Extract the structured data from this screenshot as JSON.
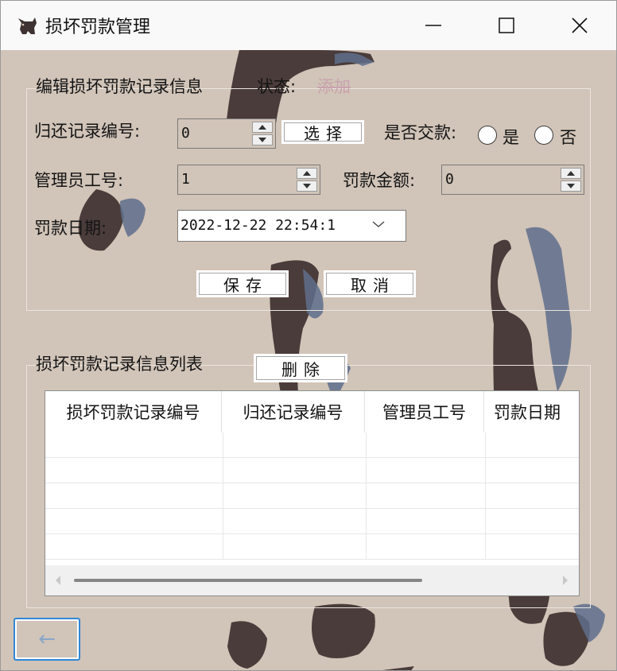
{
  "window": {
    "title": "损坏罚款管理",
    "icon": "cat-icon",
    "controls": [
      "minimize-icon",
      "maximize-icon",
      "close-icon"
    ]
  },
  "edit_group": {
    "legend": "编辑损坏罚款记录信息",
    "status_label": "状态:",
    "status_value": "添加",
    "return_record_label": "归还记录编号:",
    "return_record_value": "0",
    "select_button": "选择",
    "paid_label": "是否交款:",
    "paid_yes": "是",
    "paid_no": "否",
    "admin_id_label": "管理员工号:",
    "admin_id_value": "1",
    "fine_amount_label": "罚款金额:",
    "fine_amount_value": "0",
    "fine_date_label": "罚款日期:",
    "fine_date_value": "2022-12-22 22:54:1",
    "save_button": "保存",
    "cancel_button": "取消"
  },
  "list_group": {
    "legend": "损坏罚款记录信息列表",
    "delete_button": "删除",
    "columns": [
      "损坏罚款记录编号",
      "归还记录编号",
      "管理员工号",
      "罚款日期"
    ],
    "rows": []
  },
  "back_button": "←",
  "colors": {
    "background": "#d1c4b8",
    "titlebar": "#f9f9f9",
    "status_value": "#c9a3ad",
    "focus_border": "#2f87d6"
  }
}
